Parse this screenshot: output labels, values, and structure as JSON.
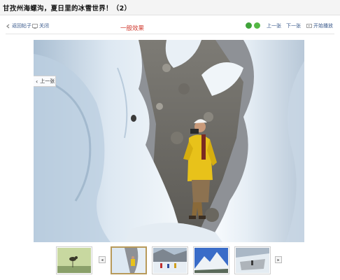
{
  "page": {
    "title": "甘孜州海螺沟，夏日里的冰雪世界！（2）"
  },
  "toolbar": {
    "back_label": "返回帖子",
    "close_label": "关闭",
    "mode_label": "一般效果",
    "prev_label": "上一张",
    "next_label": "下一张",
    "slideshow_label": "开始播放"
  },
  "viewer": {
    "prev_overlay_label": "上一张",
    "prev_arrow": "‹"
  },
  "thumbnails": {
    "prev_arrow": "◂",
    "next_arrow": "▸",
    "selected_index": 1,
    "items": [
      {
        "subject": "bird"
      },
      {
        "subject": "climber-ice-cave"
      },
      {
        "subject": "glacier-group"
      },
      {
        "subject": "snow-mountain"
      },
      {
        "subject": "glacier-climber"
      }
    ]
  },
  "colors": {
    "link": "#3a5a8c",
    "mode_label": "#d03a2f",
    "selected_border": "#b89a5a",
    "green_icon": "#3fa33a"
  },
  "icons": [
    "back-arrow-icon",
    "close-window-icon",
    "green-refresh-icon",
    "green-leaf-icon",
    "play-icon",
    "chevron-left-icon"
  ]
}
